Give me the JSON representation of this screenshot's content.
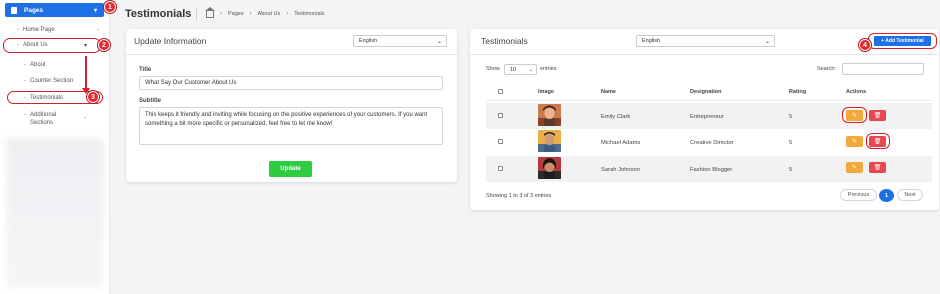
{
  "sidebar": {
    "pages_label": "Pages",
    "items": [
      {
        "label": "Home Page"
      },
      {
        "label": "About Us"
      },
      {
        "label": "About"
      },
      {
        "label": "Counter Section"
      },
      {
        "label": "Testimonials"
      },
      {
        "label": "Additional Sections"
      }
    ]
  },
  "annotations": {
    "b1": "1",
    "b2": "2",
    "b3": "3",
    "b4": "4"
  },
  "header": {
    "title": "Testimonials",
    "breadcrumb": [
      "Pages",
      "About Us",
      "Testimonials"
    ]
  },
  "update_panel": {
    "title": "Update Information",
    "language": "English",
    "title_label": "Title",
    "title_value": "What Say Our Customer About Us",
    "subtitle_label": "Subtitle",
    "subtitle_value": "This keeps it friendly and inviting while focusing on the positive experiences of your customers. If you want something a bit more specific or personalized, feel free to let me know!",
    "update_button": "Update"
  },
  "testimonials_panel": {
    "title": "Testimonials",
    "language": "English",
    "add_button": "+ Add Testimonial",
    "show_label": "Show",
    "entries_value": "10",
    "entries_label": "entries",
    "search_label": "Search:",
    "columns": [
      "Image",
      "Name",
      "Designation",
      "Rating",
      "Actions"
    ],
    "rows": [
      {
        "name": "Emily Clark",
        "designation": "Entrepreneur",
        "rating": "5"
      },
      {
        "name": "Michael Adams",
        "designation": "Creative Director",
        "rating": "5"
      },
      {
        "name": "Sarah Johnson",
        "designation": "Fashion Blogger",
        "rating": "5"
      }
    ],
    "footer_info": "Showing 1 to 3 of 3 entries",
    "pager": {
      "prev": "Previous",
      "current": "1",
      "next": "Next"
    }
  },
  "colors": {
    "primary": "#1f6fe5",
    "success": "#2ecc40",
    "warning": "#f2a93b",
    "danger": "#e9474f",
    "annotation": "#d4202b"
  }
}
